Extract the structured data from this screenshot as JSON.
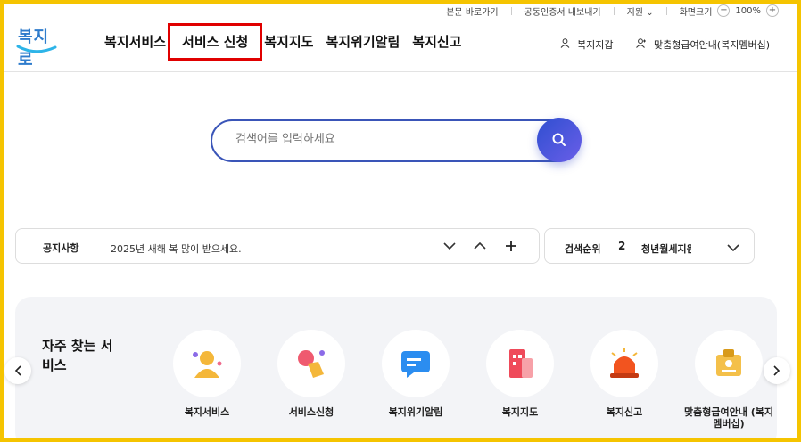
{
  "utility": {
    "skip_label": "본문 바로가기",
    "cert_label": "공동인증서 내보내기",
    "lang_label": "지원",
    "zoom_label": "화면크기",
    "zoom_value": "100%"
  },
  "logo": {
    "text": "복지로"
  },
  "gnb": [
    {
      "label": "복지서비스"
    },
    {
      "label": "서비스 신청"
    },
    {
      "label": "복지지도"
    },
    {
      "label": "복지위기알림"
    },
    {
      "label": "복지신고"
    }
  ],
  "header_right": {
    "wallet_label": "복지지갑",
    "custom_label": "맞춤형급여안내(복지멤버십)"
  },
  "search": {
    "placeholder": "검색어를 입력하세요"
  },
  "notice": {
    "title": "공지사항",
    "text": "2025년 새해 복 많이 받으세요."
  },
  "rank": {
    "title": "검색순위",
    "number": "2",
    "keyword": "청년월세지원"
  },
  "quick": {
    "title": "자주 찾는 서비스",
    "items": [
      {
        "label": "복지서비스",
        "icon": "person-icon"
      },
      {
        "label": "서비스신청",
        "icon": "hand-click-icon"
      },
      {
        "label": "복지위기알림",
        "icon": "chat-bubble-icon"
      },
      {
        "label": "복지지도",
        "icon": "building-icon"
      },
      {
        "label": "복지신고",
        "icon": "siren-icon"
      },
      {
        "label": "맞춤형급여안내 (복지멤버십)",
        "icon": "id-card-icon"
      }
    ]
  },
  "colors": {
    "accent": "#3a55b8",
    "highlight": "#e00000",
    "frame": "#f5c400"
  }
}
